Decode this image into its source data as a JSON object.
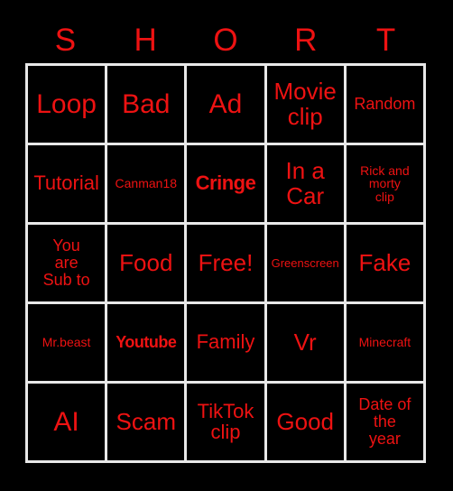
{
  "card": {
    "title_letters": [
      "S",
      "H",
      "O",
      "R",
      "T"
    ],
    "background_color": "#000000",
    "text_color": "#ee1212",
    "grid_line_color": "#e8e8e8",
    "rows": 5,
    "columns": 5
  },
  "cells": [
    {
      "text": "Loop",
      "size": "xl",
      "bold": false
    },
    {
      "text": "Bad",
      "size": "xl",
      "bold": false
    },
    {
      "text": "Ad",
      "size": "xl",
      "bold": false
    },
    {
      "text": "Movie\nclip",
      "size": "lg",
      "bold": false
    },
    {
      "text": "Random",
      "size": "sm",
      "bold": false
    },
    {
      "text": "Tutorial",
      "size": "md",
      "bold": false
    },
    {
      "text": "Canman18",
      "size": "xs",
      "bold": false
    },
    {
      "text": "Cringe",
      "size": "md",
      "bold": true
    },
    {
      "text": "In a\nCar",
      "size": "lg",
      "bold": false
    },
    {
      "text": "Rick and\nmorty\nclip",
      "size": "xs",
      "bold": false
    },
    {
      "text": "You\nare\nSub to",
      "size": "sm",
      "bold": false
    },
    {
      "text": "Food",
      "size": "lg",
      "bold": false
    },
    {
      "text": "Free!",
      "size": "lg",
      "bold": false
    },
    {
      "text": "Greenscreen",
      "size": "xxs",
      "bold": false
    },
    {
      "text": "Fake",
      "size": "lg",
      "bold": false
    },
    {
      "text": "Mr.beast",
      "size": "xs",
      "bold": false
    },
    {
      "text": "Youtube",
      "size": "sm",
      "bold": true
    },
    {
      "text": "Family",
      "size": "md",
      "bold": false
    },
    {
      "text": "Vr",
      "size": "lg",
      "bold": false
    },
    {
      "text": "Minecraft",
      "size": "xs",
      "bold": false
    },
    {
      "text": "AI",
      "size": "xl",
      "bold": false
    },
    {
      "text": "Scam",
      "size": "lg",
      "bold": false
    },
    {
      "text": "TikTok\nclip",
      "size": "md",
      "bold": false
    },
    {
      "text": "Good",
      "size": "lg",
      "bold": false
    },
    {
      "text": "Date of\nthe\nyear",
      "size": "sm",
      "bold": false
    }
  ]
}
